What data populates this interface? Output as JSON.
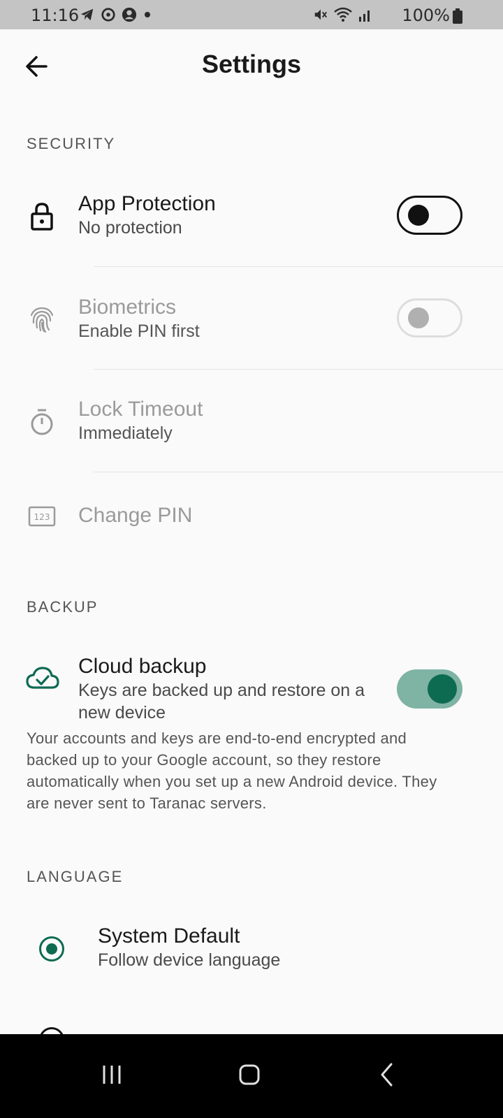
{
  "status_bar": {
    "time": "11:16",
    "battery": "100%",
    "left_icons": [
      "telegram-icon",
      "sync-icon",
      "account-icon",
      "dot-icon"
    ],
    "right_icons": [
      "mute-icon",
      "wifi-icon",
      "signal-icon",
      "battery-icon"
    ]
  },
  "app_bar": {
    "title": "Settings"
  },
  "security": {
    "header": "SECURITY",
    "app_protection": {
      "title": "App Protection",
      "subtitle": "No protection",
      "enabled": false
    },
    "biometrics": {
      "title": "Biometrics",
      "subtitle": "Enable PIN first",
      "enabled": false,
      "disabled": true
    },
    "lock_timeout": {
      "title": "Lock Timeout",
      "subtitle": "Immediately",
      "disabled": true
    },
    "change_pin": {
      "title": "Change PIN",
      "disabled": true
    }
  },
  "backup": {
    "header": "BACKUP",
    "cloud_backup": {
      "title": "Cloud backup",
      "subtitle": "Keys are backed up and restore on a new device",
      "enabled": true
    },
    "description": "Your accounts and keys are end-to-end encrypted and backed up to your Google account, so they restore automatically when you set up a new Android device. They are never sent to Taranac servers."
  },
  "language": {
    "header": "LANGUAGE",
    "options": [
      {
        "title": "System Default",
        "subtitle": "Follow device language",
        "selected": true
      }
    ]
  },
  "colors": {
    "accent": "#0d6b52",
    "accent_track": "#7fb3a3",
    "background": "#fafafa"
  }
}
